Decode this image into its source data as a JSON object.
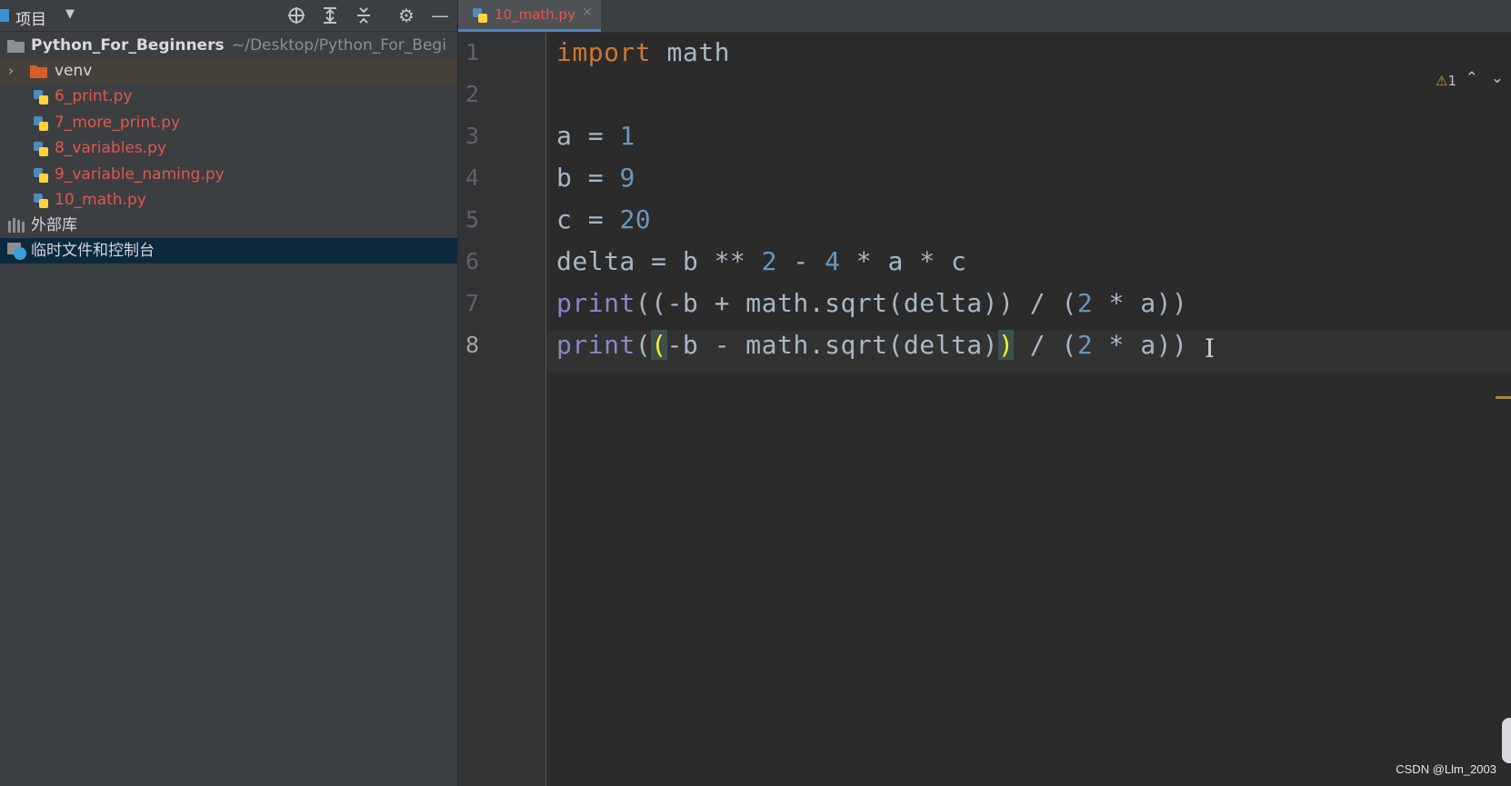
{
  "sidebar": {
    "header_title": "项目",
    "tree": {
      "root_name": "Python_For_Beginners",
      "root_path": "~/Desktop/Python_For_Begi",
      "venv_label": "venv",
      "files": [
        "6_print.py",
        "7_more_print.py",
        "8_variables.py",
        "9_variable_naming.py",
        "10_math.py"
      ],
      "external_libs": "外部库",
      "scratches": "临时文件和控制台"
    }
  },
  "editor": {
    "tab_label": "10_math.py",
    "warning_count": "1",
    "line_numbers": [
      "1",
      "2",
      "3",
      "4",
      "5",
      "6",
      "7",
      "8"
    ],
    "current_line": "8",
    "code": {
      "l1": {
        "kw": "import",
        "rest": " math"
      },
      "l3": {
        "a": "a = ",
        "n": "1"
      },
      "l4": {
        "a": "b = ",
        "n": "9"
      },
      "l5": {
        "a": "c = ",
        "n": "20"
      },
      "l6": {
        "a": "delta = b ** ",
        "n1": "2",
        "b": " - ",
        "n2": "4",
        "c": " * a * c"
      },
      "l7": {
        "fn": "print",
        "a": "((-b + math.sqrt(delta)) / (",
        "n": "2",
        "b": " * a))"
      },
      "l8": {
        "fn": "print",
        "p1": "(",
        "br1": "(",
        "a": "-b - math.sqrt(delta)",
        "br2": ")",
        "b": " / (",
        "n": "2",
        "c": " * a))"
      }
    }
  },
  "watermark": "CSDN @Llm_2003"
}
